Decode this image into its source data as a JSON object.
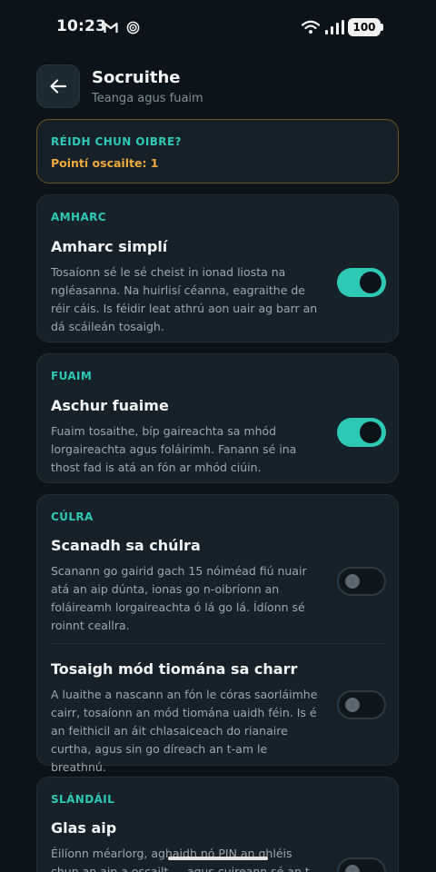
{
  "status_bar": {
    "time": "10:23",
    "battery": "100",
    "icons": [
      "gmail-icon",
      "sync-icon",
      "wifi-icon",
      "signal-icon",
      "battery-icon"
    ]
  },
  "header": {
    "title": "Socruithe",
    "subtitle": "Teanga agus fuaim",
    "back_icon": "arrow-left-icon"
  },
  "ready_card": {
    "title": "RÉIDH CHUN OIBRE?",
    "points": "Pointí oscailte: 1"
  },
  "sections": [
    {
      "label": "AMHARC",
      "settings": [
        {
          "title": "Amharc simplí",
          "description": "Tosaíonn sé le sé cheist in ionad liosta na ngléasanna. Na huirlisí céanna, eagraithe de réir cáis. Is féidir leat athrú aon uair ag barr an dá scáileán tosaigh.",
          "enabled": true
        }
      ]
    },
    {
      "label": "FUAIM",
      "settings": [
        {
          "title": "Aschur fuaime",
          "description": "Fuaim tosaithe, bíp gaireachta sa mhód lorgaireachta agus foláirimh. Fanann sé ina thost fad is atá an fón ar mhód ciúin.",
          "enabled": true
        }
      ]
    },
    {
      "label": "CÚLRA",
      "settings": [
        {
          "title": "Scanadh sa chúlra",
          "description": "Scanann go gairid gach 15 nóiméad fiú nuair atá an aip dúnta, ionas go n-oibríonn an foláireamh lorgaireachta ó lá go lá. Ídíonn sé roinnt ceallra.",
          "enabled": false
        },
        {
          "title": "Tosaigh mód tiomána sa charr",
          "description": "A luaithe a nascann an fón le córas saorláimhe cairr, tosaíonn an mód tiomána uaidh féin. Is é an feithicil an áit chlasaiceach do rianaire curtha, agus sin go díreach an t-am le breathnú.",
          "enabled": false
        }
      ]
    },
    {
      "label": "SLÁNDÁIL",
      "settings": [
        {
          "title": "Glas aip",
          "description": "Éilíonn méarlorg, aghaidh nó PIN an ghléis chun an aip a oscailt — agus cuireann sé an t-ábhar i",
          "enabled": false
        }
      ]
    }
  ],
  "colors": {
    "background": "#0d1419",
    "card": "#172129",
    "accent": "#2ec9b4",
    "warning": "#f0a93b"
  }
}
